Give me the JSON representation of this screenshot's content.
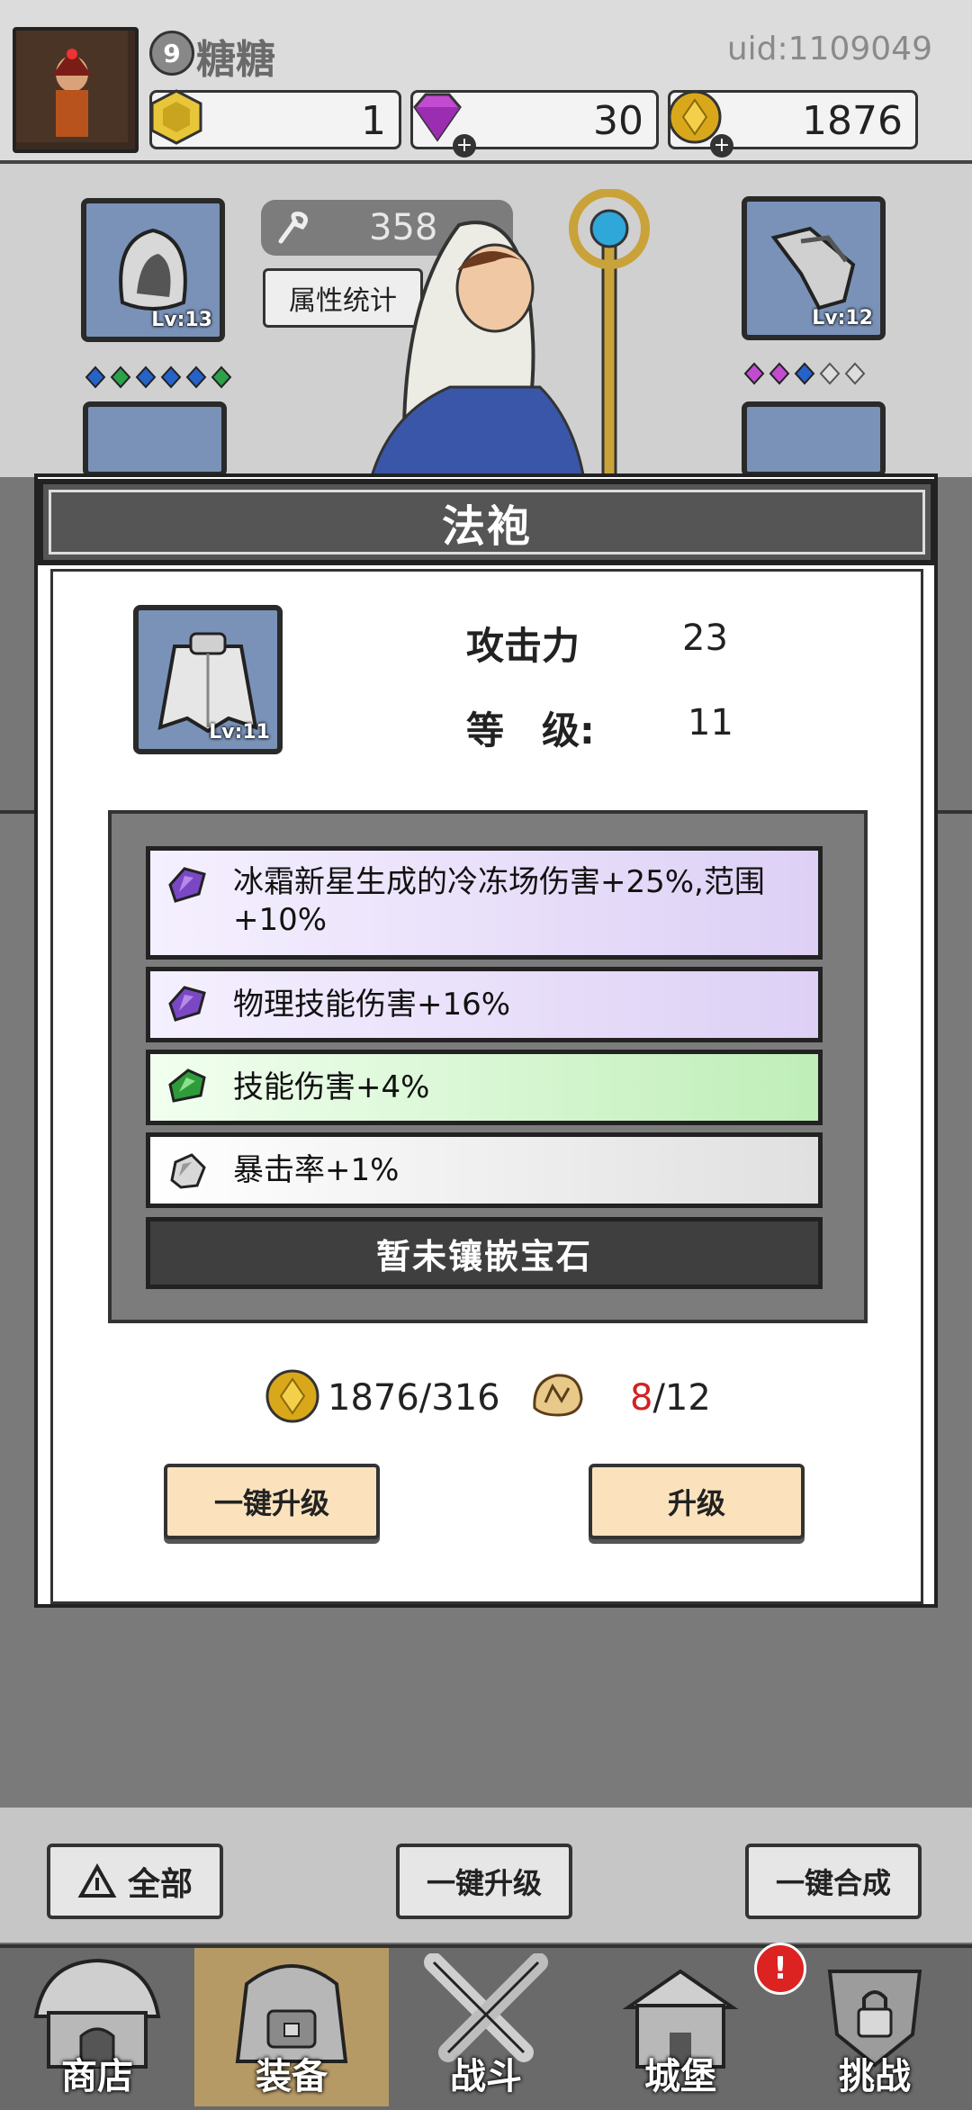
{
  "header": {
    "player_level": "9",
    "player_name": "糖糖",
    "uid": "uid:1109049",
    "resources": [
      {
        "icon": "hexagon-token-icon",
        "value": "1",
        "color": "#e7c63a"
      },
      {
        "icon": "diamond-icon",
        "value": "30",
        "color": "#c24bd1"
      },
      {
        "icon": "gold-coin-icon",
        "value": "1876",
        "color": "#d9a81a"
      }
    ]
  },
  "character": {
    "power": "358",
    "stats_button": "属性统计",
    "left_slot": {
      "icon": "hood-icon",
      "level": "Lv:13"
    },
    "right_slot": {
      "icon": "bracer-icon",
      "level": "Lv:12"
    }
  },
  "modal": {
    "title": "法袍",
    "item": {
      "icon": "cloak-icon",
      "level": "Lv:11"
    },
    "attack_label": "攻击力",
    "attack_value": "23",
    "level_label": "等　级:",
    "level_value": "11",
    "affixes": [
      {
        "gem": "purple-gem-icon",
        "text": "冰霜新星生成的冷冻场伤害+25%,范围+10%",
        "tier": "purple"
      },
      {
        "gem": "purple-gem-icon",
        "text": "物理技能伤害+16%",
        "tier": "purple"
      },
      {
        "gem": "green-gem-icon",
        "text": "技能伤害+4%",
        "tier": "green"
      },
      {
        "gem": "grey-stone-icon",
        "text": "暴击率+1%",
        "tier": "grey"
      }
    ],
    "no_gem_text": "暂未镶嵌宝石",
    "gold_cost": "1876/316",
    "scroll_have": "8",
    "scroll_need": "/12",
    "one_key_upgrade": "一键升级",
    "upgrade": "升级"
  },
  "controls": {
    "filter_all": "全部",
    "one_key_upgrade": "一键升级",
    "one_key_merge": "一键合成"
  },
  "nav": [
    {
      "icon": "shop-hut-icon",
      "label": "商店"
    },
    {
      "icon": "backpack-icon",
      "label": "装备"
    },
    {
      "icon": "crossed-swords-icon",
      "label": "战斗"
    },
    {
      "icon": "castle-icon",
      "label": "城堡"
    },
    {
      "icon": "locked-shield-icon",
      "label": "挑战"
    }
  ],
  "colors": {
    "accent_red": "#d22222",
    "upgrade_button": "#fbe2bd"
  }
}
